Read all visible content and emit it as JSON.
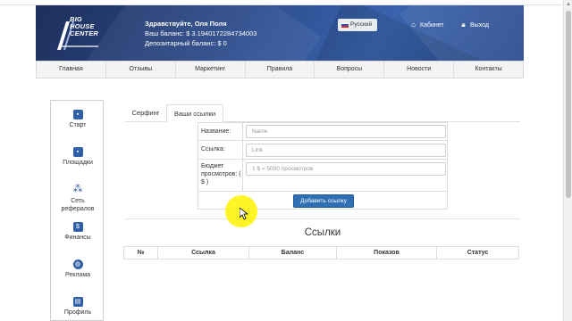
{
  "header": {
    "logo_text": [
      "BIG",
      "HOUSE",
      "CENTER"
    ],
    "greeting": "Здравствуйте, Оля Поля",
    "balance": "Ваш баланс: $ 3.1940172284734003",
    "deposit": "Депозитарный баланс: $ 0",
    "language": "Русский",
    "cabinet": "Кабинет",
    "logout": "Выход"
  },
  "nav": {
    "items": [
      "Главная",
      "Отзывы",
      "Маркетинг",
      "Правила",
      "Вопросы",
      "Новости",
      "Контакты"
    ]
  },
  "sidebar": {
    "items": [
      {
        "label": "Старт",
        "icon": "start-icon"
      },
      {
        "label": "Площадки",
        "icon": "sites-icon"
      },
      {
        "label": "Сеть рефералов",
        "icon": "network-icon"
      },
      {
        "label": "Финансы",
        "icon": "wallet-icon"
      },
      {
        "label": "Реклама",
        "icon": "globe-icon"
      },
      {
        "label": "Профиль",
        "icon": "profile-icon"
      }
    ]
  },
  "tabs": [
    "Серфинг",
    "Ваши ссылки"
  ],
  "form": {
    "name_label": "Название:",
    "name_placeholder": "Name",
    "link_label": "Ссылка:",
    "link_placeholder": "Link",
    "budget_label": "Бюджет просмотров: ( $ )",
    "budget_placeholder": "1 $ = 5000 просмотров",
    "submit": "Добавить ссылку"
  },
  "links_section": {
    "title": "Ссылки",
    "columns": [
      "№",
      "Ссылка",
      "Баланс",
      "Показов",
      "Статус"
    ]
  },
  "colors": {
    "accent": "#2f6fb3",
    "header_dark": "#1e2f5c",
    "cursor_highlight": "#fff300"
  }
}
